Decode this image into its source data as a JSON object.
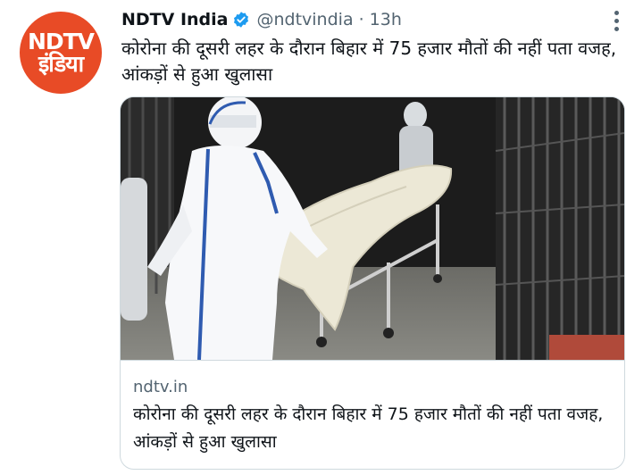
{
  "tweet": {
    "display_name": "NDTV India",
    "handle": "@ndtvindia",
    "separator": "·",
    "time": "13h",
    "text": "कोरोना की दूसरी लहर के दौरान बिहार में 75 हजार मौतों की नहीं पता वजह, आंकड़ों से हुआ खुलासा",
    "avatar_text": "NDTV इंडिया",
    "verified_icon": "verified-badge-icon",
    "more_icon": "more-options-icon"
  },
  "card": {
    "domain": "ndtv.in",
    "title": "कोरोना की दूसरी लहर के दौरान बिहार में 75 हजार मौतों की नहीं पता वजह, आंकड़ों से हुआ खुलासा"
  },
  "colors": {
    "avatar_bg": "#e84b26",
    "verified": "#1d9bf0",
    "secondary_text": "#536471",
    "border": "#cfd9de"
  }
}
